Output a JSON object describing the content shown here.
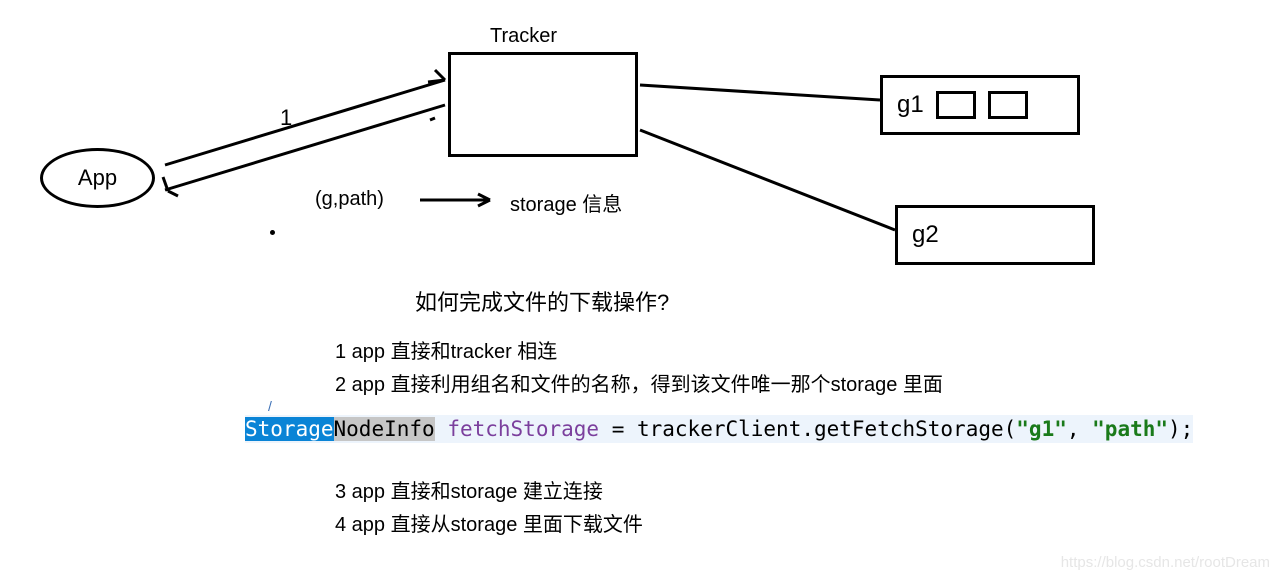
{
  "nodes": {
    "app": "App",
    "tracker_label": "Tracker",
    "g1": "g1",
    "g2": "g2"
  },
  "edges": {
    "num1": "1",
    "gpath": "(g,path)",
    "storage_info": "storage 信息"
  },
  "question": "如何完成文件的下载操作?",
  "steps": {
    "s1": "1 app 直接和tracker 相连",
    "s2": "2 app 直接利用组名和文件的名称，得到该文件唯一那个storage 里面",
    "s3": "3 app 直接和storage 建立连接",
    "s4": "4 app 直接从storage 里面下载文件"
  },
  "code": {
    "t1": "Storage",
    "t2": "NodeInfo",
    "sp1": " ",
    "t3": "fetchStorage",
    "t4": " = trackerClient.getFetchStorage(",
    "t5": "\"g1\"",
    "t6": ", ",
    "t7": "\"path\"",
    "t8": ");"
  },
  "watermark": "https://blog.csdn.net/rootDream"
}
